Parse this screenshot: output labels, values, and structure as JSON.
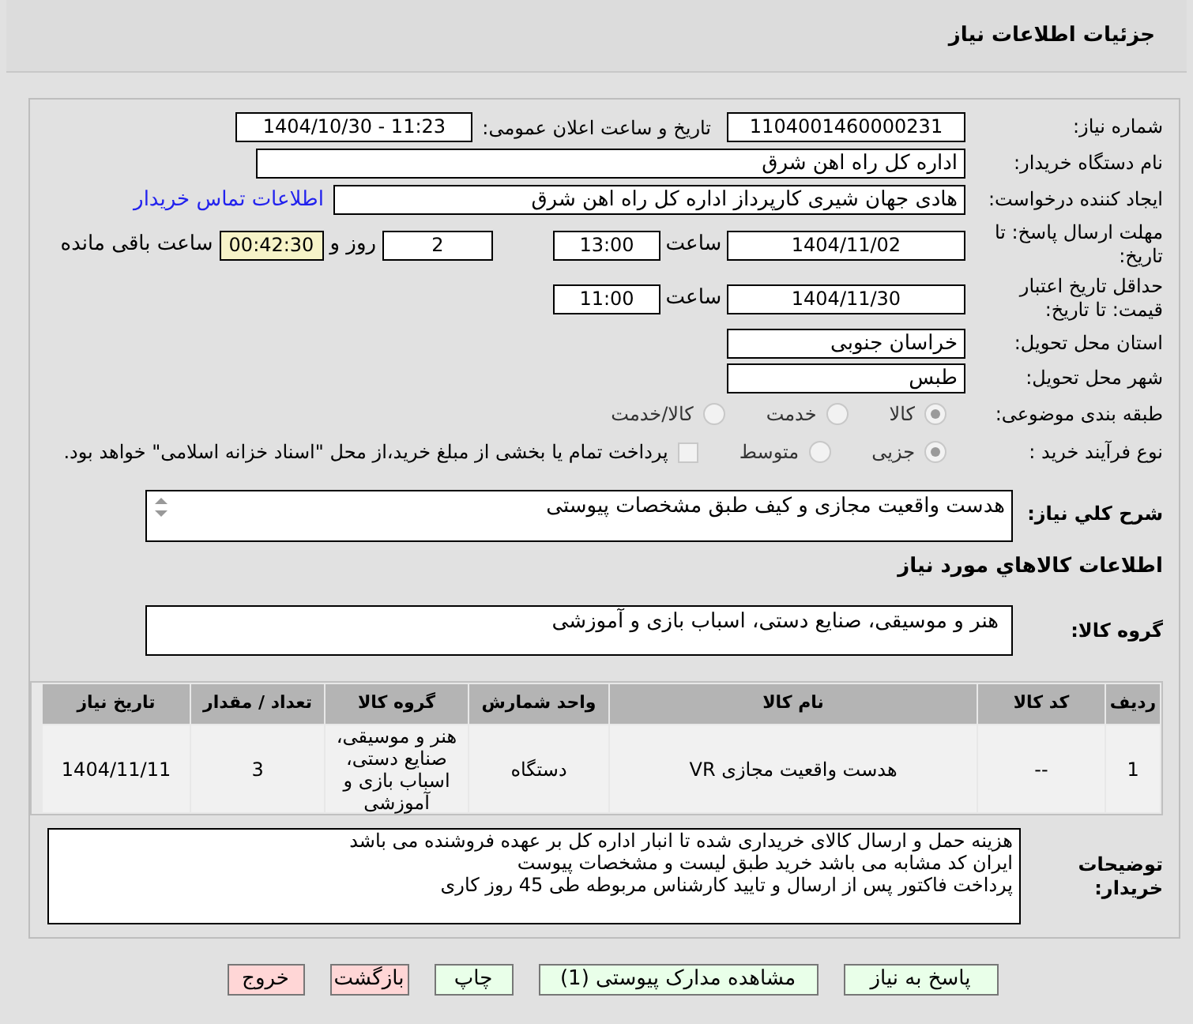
{
  "header": {
    "title": "جزئیات اطلاعات نیاز"
  },
  "need_number": {
    "label": "شماره نیاز:",
    "value": "1104001460000231"
  },
  "announce": {
    "label": "تاریخ و ساعت اعلان عمومی:",
    "value": "1404/10/30 - 11:23"
  },
  "buyer": {
    "label": "نام دستگاه خریدار:",
    "value": "اداره کل راه اهن شرق"
  },
  "requester": {
    "label": "ایجاد کننده درخواست:",
    "value": "هادی جهان شیری کارپرداز اداره کل راه اهن شرق",
    "link": "اطلاعات تماس خریدار"
  },
  "deadline": {
    "label": "مهلت ارسال پاسخ: تا تاریخ:",
    "date": "1404/11/02",
    "time_label": "ساعت",
    "time": "13:00",
    "days": "2",
    "days_label": "روز و",
    "remaining": "00:42:30",
    "remaining_label": "ساعت باقی مانده"
  },
  "validity": {
    "label": "حداقل تاریخ اعتبار قیمت: تا تاریخ:",
    "date": "1404/11/30",
    "time_label": "ساعت",
    "time": "11:00"
  },
  "province": {
    "label": "استان محل تحویل:",
    "value": "خراسان جنوبی"
  },
  "city": {
    "label": "شهر محل تحویل:",
    "value": "طبس"
  },
  "category": {
    "label": "طبقه بندی موضوعی:",
    "options": [
      {
        "label": "کالا",
        "selected": true
      },
      {
        "label": "خدمت",
        "selected": false
      },
      {
        "label": "کالا/خدمت",
        "selected": false
      }
    ]
  },
  "process": {
    "label": "نوع فرآیند خرید :",
    "options": [
      {
        "label": "جزیی",
        "selected": true
      },
      {
        "label": "متوسط",
        "selected": false
      }
    ],
    "payment": {
      "checked": false,
      "label": "پرداخت تمام یا بخشی از مبلغ خرید،از محل \"اسناد خزانه اسلامی\" خواهد بود."
    }
  },
  "summary": {
    "label": "شرح کلي نياز:",
    "value": "هدست واقعیت مجازی و کیف طبق مشخصات پیوستی"
  },
  "goods_heading": "اطلاعات كالاهاي مورد نياز",
  "goods_group": {
    "label": "گروه کالا:",
    "value": "هنر و موسیقی، صنایع دستی، اسباب بازی و آموزشی"
  },
  "table": {
    "columns": [
      "ردیف",
      "کد کالا",
      "نام کالا",
      "واحد شمارش",
      "گروه کالا",
      "تعداد / مقدار",
      "تاریخ نیاز"
    ],
    "rows": [
      [
        "1",
        "--",
        "هدست واقعیت مجازی VR",
        "دستگاه",
        "هنر و موسیقی، صنایع دستی، اسباب بازی و آموزشی",
        "3",
        "1404/11/11"
      ]
    ]
  },
  "notes": {
    "label": "توضیحات خریدار:",
    "lines": [
      "هزینه حمل و ارسال کالای خریداری شده تا انبار اداره کل بر عهده فروشنده می باشد",
      "ایران کد مشابه می باشد خرید طبق لیست و مشخصات پیوست",
      "پرداخت فاکتور پس از ارسال و تایید کارشناس مربوطه طی 45 روز کاری"
    ]
  },
  "buttons": [
    {
      "label": "پاسخ به نیاز",
      "kind": "normal"
    },
    {
      "label": "مشاهده مدارک پیوستی (1)",
      "kind": "normal"
    },
    {
      "label": "چاپ",
      "kind": "normal"
    },
    {
      "label": "بازگشت",
      "kind": "danger"
    },
    {
      "label": "خروج",
      "kind": "danger"
    }
  ]
}
